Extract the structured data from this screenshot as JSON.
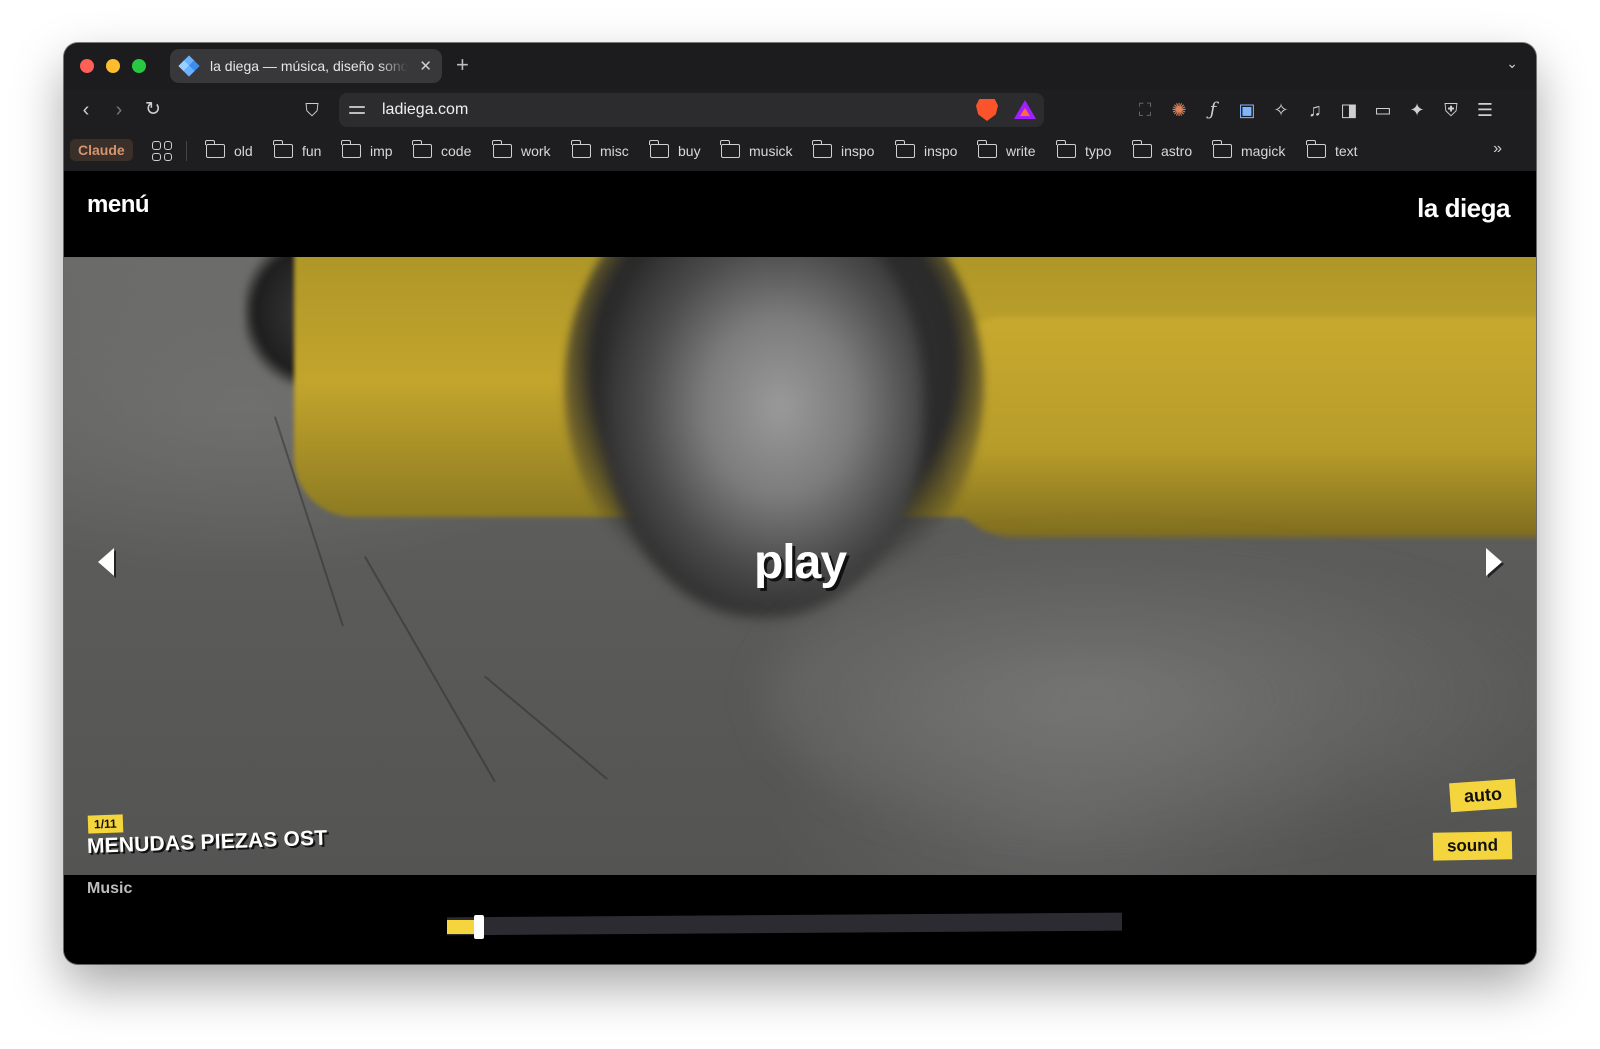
{
  "browser": {
    "tab": {
      "title": "la diega — música, diseño sonoro",
      "favicon": "diamond-favicon-icon"
    },
    "new_tab_label": "+",
    "address": "ladiega.com",
    "toolbar_icons": [
      "back-arrow-icon",
      "forward-arrow-icon",
      "reload-icon",
      "bookmark-icon",
      "site-settings-icon",
      "brave-shields-icon",
      "brave-rewards-icon",
      "screenshot-icon",
      "claude-extension-icon",
      "font-finder-icon",
      "extension-icon",
      "puzzle-icon",
      "music-icon",
      "sidebar-icon",
      "wallet-icon",
      "leo-ai-icon",
      "vpn-shield-icon",
      "hamburger-menu-icon"
    ],
    "bookmarks": {
      "claude": "Claude",
      "folders": [
        "old",
        "fun",
        "imp",
        "code",
        "work",
        "misc",
        "buy",
        "musick",
        "inspo",
        "inspo",
        "write",
        "typo",
        "astro",
        "magick",
        "text"
      ]
    }
  },
  "site": {
    "menu": "menú",
    "logo": "la diega",
    "player": {
      "play_label": "play",
      "counter": "1/11",
      "title": "MENUDAS PIEZAS OST",
      "category": "Music",
      "auto_label": "auto",
      "sound_label": "sound",
      "progress": 0.04
    },
    "colors": {
      "accent": "#f5d53d",
      "background": "#000000"
    }
  }
}
